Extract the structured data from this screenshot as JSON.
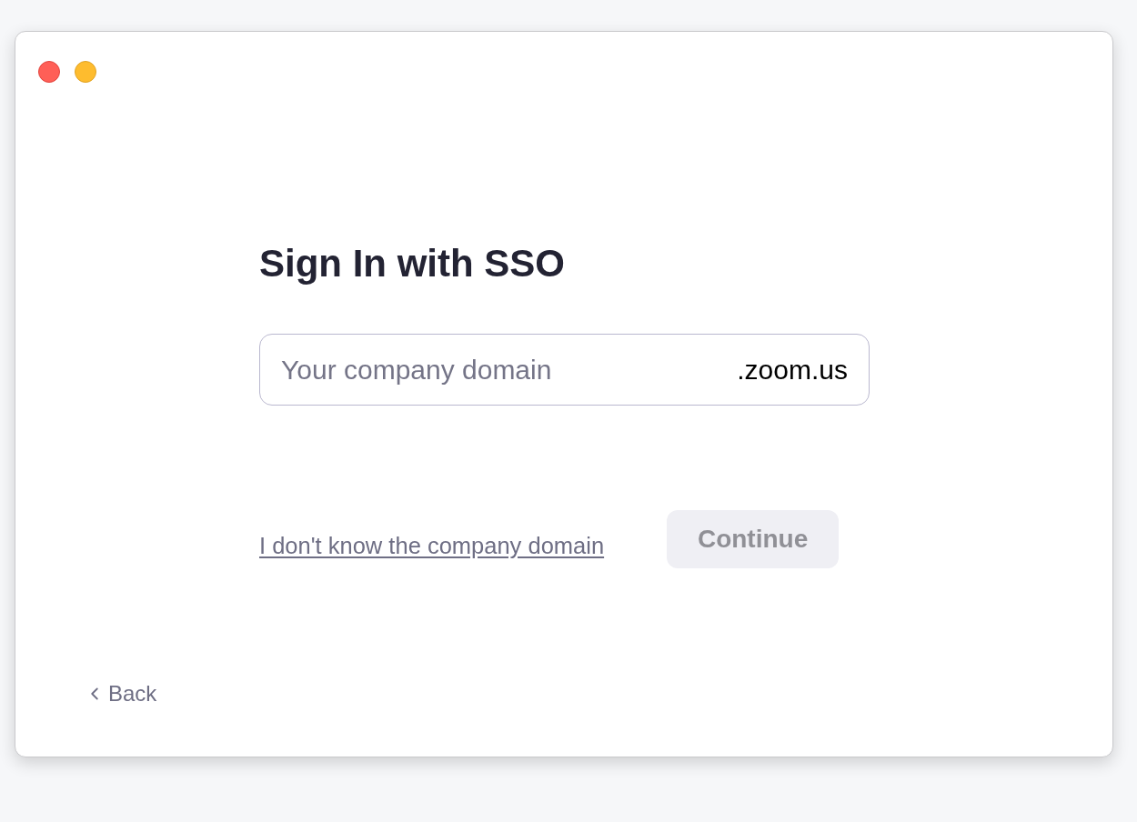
{
  "window": {
    "controls": [
      {
        "kind": "close",
        "color": "#ff5f57"
      },
      {
        "kind": "minimize",
        "color": "#febc2e"
      }
    ]
  },
  "heading": "Sign In with SSO",
  "domain_field": {
    "placeholder": "Your company domain",
    "suffix": ".zoom.us"
  },
  "help_link": "I don't know the company domain",
  "continue_button": {
    "label": "Continue",
    "disabled": true
  },
  "back_button": {
    "label": "Back"
  }
}
